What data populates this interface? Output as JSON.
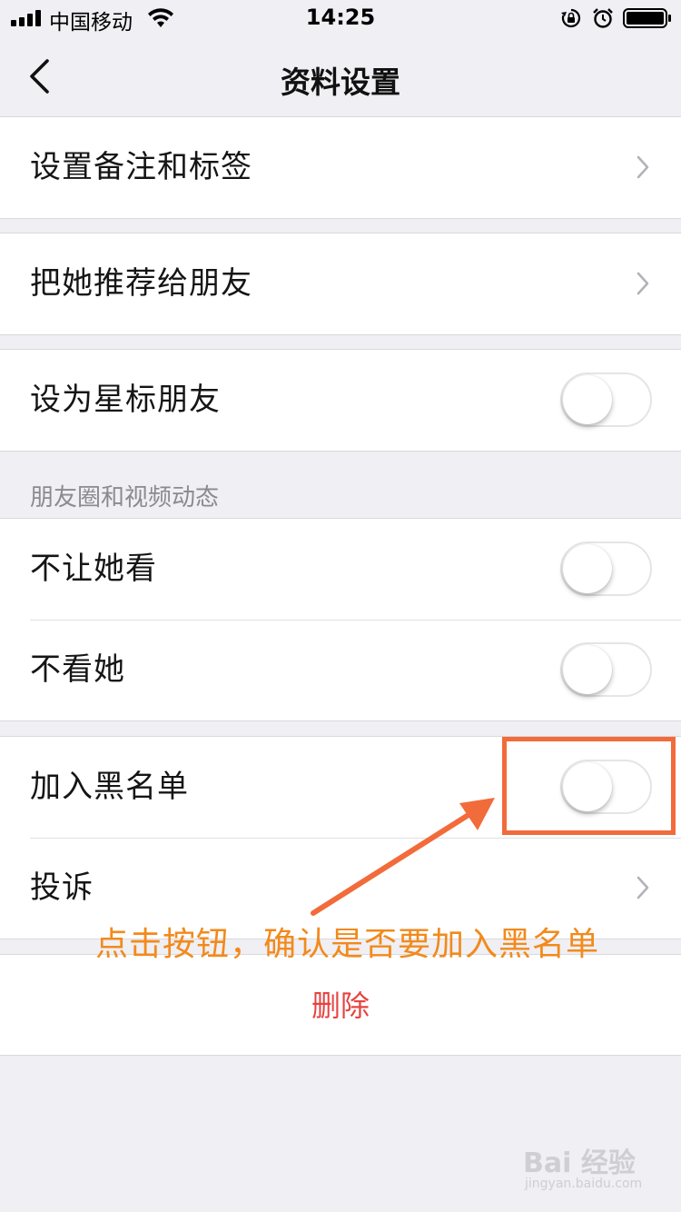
{
  "status_bar": {
    "carrier": "中国移动",
    "time": "14:25"
  },
  "nav": {
    "title": "资料设置"
  },
  "rows": {
    "remark": {
      "label": "设置备注和标签"
    },
    "recommend": {
      "label": "把她推荐给朋友"
    },
    "star": {
      "label": "设为星标朋友",
      "on": false
    },
    "hide_from": {
      "label": "不让她看",
      "on": false
    },
    "dont_see": {
      "label": "不看她",
      "on": false
    },
    "blacklist": {
      "label": "加入黑名单",
      "on": false
    },
    "complain": {
      "label": "投诉"
    }
  },
  "section_moments": {
    "header": "朋友圈和视频动态"
  },
  "delete": {
    "label": "删除",
    "color": "#e64340"
  },
  "annotation": {
    "text": "点击按钮，确认是否要加入黑名单",
    "color": "#f28a1b",
    "box_color": "#f26b3a"
  },
  "watermark": {
    "brand": "Bai  经验",
    "url": "jingyan.baidu.com"
  }
}
